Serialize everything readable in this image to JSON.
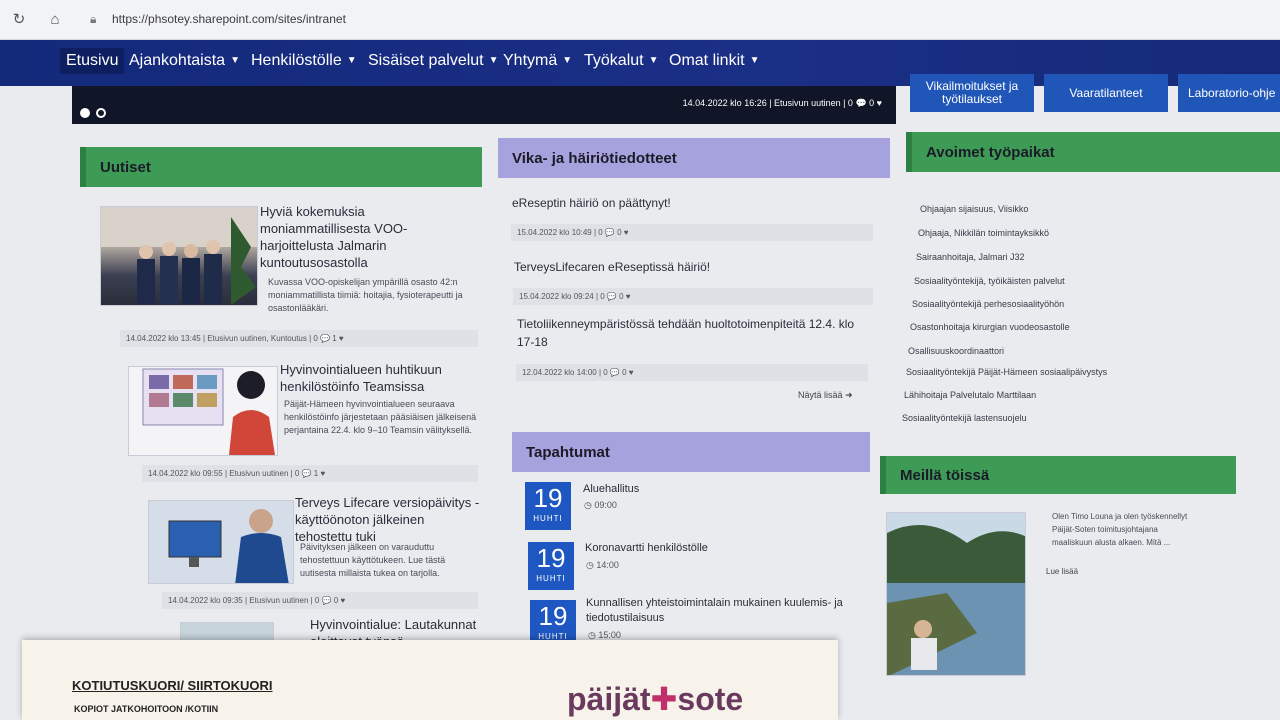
{
  "browser": {
    "url": "https://phsotey.sharepoint.com/sites/intranet"
  },
  "nav": {
    "items": [
      {
        "label": "Etusivu"
      },
      {
        "label": "Ajankohtaista"
      },
      {
        "label": "Henkilöstölle"
      },
      {
        "label": "Sisäiset palvelut"
      },
      {
        "label": "Yhtymä"
      },
      {
        "label": "Työkalut"
      },
      {
        "label": "Omat linkit"
      }
    ]
  },
  "hero": {
    "meta": "14.04.2022 klo 16:26 | Etusivun uutinen | 0 💬 0 ♥"
  },
  "quicklinks": [
    "Vikailmoitukset ja työtilaukset",
    "Vaaratilanteet",
    "Laboratorio-ohje"
  ],
  "news": {
    "heading": "Uutiset",
    "items": [
      {
        "title": "Hyviä kokemuksia moniammatillisesta VOO-harjoittelusta Jalmarin kuntoutusosastolla",
        "body": "Kuvassa VOO-opiskelijan ympärillä osasto 42:n moniammatillista tiimiä: hoitajia, fysioterapeutti ja osastonlääkäri.",
        "meta": "14.04.2022 klo 13:45 | Etusivun uutinen, Kuntoutus | 0 💬 1 ♥"
      },
      {
        "title": "Hyvinvointialueen huhtikuun henkilöstöinfo Teamsissa",
        "body": "Päijät-Hämeen hyvinvointialueen seuraava henkilöstöinfo järjestetaan pääsiäisen jälkeisenä perjantaina 22.4. klo 9–10 Teamsin välityksellä.",
        "meta": "14.04.2022 klo 09:55 | Etusivun uutinen | 0 💬 1 ♥"
      },
      {
        "title": "Terveys Lifecare versiopäivitys - käyttöönoton jälkeinen tehostettu tuki",
        "body": "Päivityksen jälkeen on varauduttu tehostettuun käyttötukeen. Lue tästä uutisesta millaista tukea on tarjolla.",
        "meta": "14.04.2022 klo 09:35 | Etusivun uutinen | 0 💬 0 ♥"
      },
      {
        "title": "Hyvinvointialue: Lautakunnat aloittavat työnsä perehdytyksillä",
        "body": "",
        "meta": ""
      }
    ]
  },
  "faults": {
    "heading": "Vika- ja häiriötiedotteet",
    "items": [
      {
        "title": "eReseptin häiriö on päättynyt!",
        "meta": "15.04.2022 klo 10:49 | 0 💬 0 ♥"
      },
      {
        "title": "TerveysLifecaren eReseptissä häiriö!",
        "meta": "15.04.2022 klo 09:24 | 0 💬 0 ♥"
      },
      {
        "title": "Tietoliikenneympäristössä tehdään huoltotoimenpiteitä 12.4. klo 17-18",
        "meta": "12.04.2022 klo 14:00 | 0 💬 0 ♥"
      }
    ],
    "more": "Näytä lisää"
  },
  "events": {
    "heading": "Tapahtumat",
    "items": [
      {
        "day": "19",
        "month": "HUHTI",
        "title": "Aluehallitus",
        "time": "09:00"
      },
      {
        "day": "19",
        "month": "HUHTI",
        "title": "Koronavartti henkilöstölle",
        "time": "14:00"
      },
      {
        "day": "19",
        "month": "HUHTI",
        "title": "Kunnallisen yhteistoimintalain mukainen kuulemis- ja tiedotustilaisuus",
        "time": "15:00"
      }
    ]
  },
  "jobs": {
    "heading": "Avoimet työpaikat",
    "items": [
      "Ohjaajan sijaisuus, Viisikko",
      "Ohjaaja, Nikkilän toimintayksikkö",
      "Sairaanhoitaja, Jalmari J32",
      "Sosiaalityöntekijä, työikäisten palvelut",
      "Sosiaalityöntekijä perhesosiaalityöhön",
      "Osastonhoitaja kirurgian vuodeosastolle",
      "Osallisuuskoordinaattori",
      "Sosiaalityöntekijä Päijät-Hämeen sosiaalipäivystys",
      "Lähihoitaja Palvelutalo Marttilaan",
      "Sosiaalityöntekijä lastensuojelu"
    ]
  },
  "work": {
    "heading": "Meillä töissä",
    "body": "Olen Timo Louna ja olen työskennellyt Päijät-Soten toimitusjohtajana maaliskuun alusta alkaen. Mitä ...",
    "more": "Lue lisää"
  },
  "paper": {
    "title": "KOTIUTUSKUORI/ SIIRTOKUORI",
    "subtitle": "KOPIOT JATKOHOITOON /KOTIIN",
    "logo_left": "päijät",
    "logo_right": "sote"
  }
}
